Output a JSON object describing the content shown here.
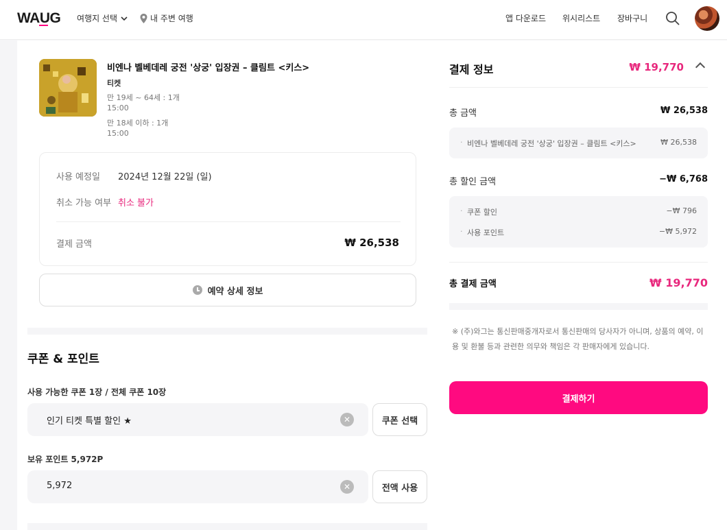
{
  "brand": {
    "logo": "WAUG",
    "accent": "#ff0080"
  },
  "header": {
    "nav_left": [
      {
        "label": "여행지 선택",
        "icon": "chevron-down-icon"
      },
      {
        "label": "내 주변 여행",
        "icon": "location-pin-icon"
      }
    ],
    "nav_right": [
      "앱 다운로드",
      "위시리스트",
      "장바구니"
    ]
  },
  "product": {
    "title": "비엔나 벨베데레 궁전 '상궁' 입장권 – 클림트 <키스>",
    "category": "티켓",
    "options": [
      {
        "line1": "만 19세 ~ 64세 : 1개",
        "line2": "15:00"
      },
      {
        "line1": "만 18세 이하 : 1개",
        "line2": "15:00"
      }
    ]
  },
  "booking": {
    "date_label": "사용 예정일",
    "date_value": "2024년 12월 22일 (일)",
    "cancel_label": "취소 가능 여부",
    "cancel_value": "취소 불가",
    "amount_label": "결제 금액",
    "amount_value": "₩ 26,538",
    "detail_button": "예약 상세 정보"
  },
  "discounts": {
    "section_title": "쿠폰 & 포인트",
    "coupon_label": "사용 가능한 쿠폰 1장 / 전체 쿠폰 10장",
    "coupon_value": "인기 티켓 특별 할인 ★",
    "coupon_button": "쿠폰 선택",
    "points_label": "보유 포인트 5,972P",
    "points_value": "5,972",
    "points_button": "전액 사용"
  },
  "payment": {
    "title": "결제 정보",
    "header_amount": "₩ 19,770",
    "total_label": "총 금액",
    "total_value": "₩ 26,538",
    "total_items": [
      {
        "label": "비엔나 벨베데레 궁전 '상궁' 입장권 – 클림트 <키스>",
        "value": "₩ 26,538"
      }
    ],
    "discount_label": "총 할인 금액",
    "discount_value": "−₩ 6,768",
    "discount_items": [
      {
        "label": "쿠폰 할인",
        "value": "−₩ 796"
      },
      {
        "label": "사용 포인트",
        "value": "−₩ 5,972"
      }
    ],
    "final_label": "총 결제 금액",
    "final_value": "₩ 19,770",
    "notice": "※ (주)와그는 통신판매중개자로서 통신판매의 당사자가 아니며, 상품의 예약, 이용 및 환불 등과 관련한 의무와 책임은 각 판매자에게 있습니다.",
    "pay_button": "결제하기"
  }
}
